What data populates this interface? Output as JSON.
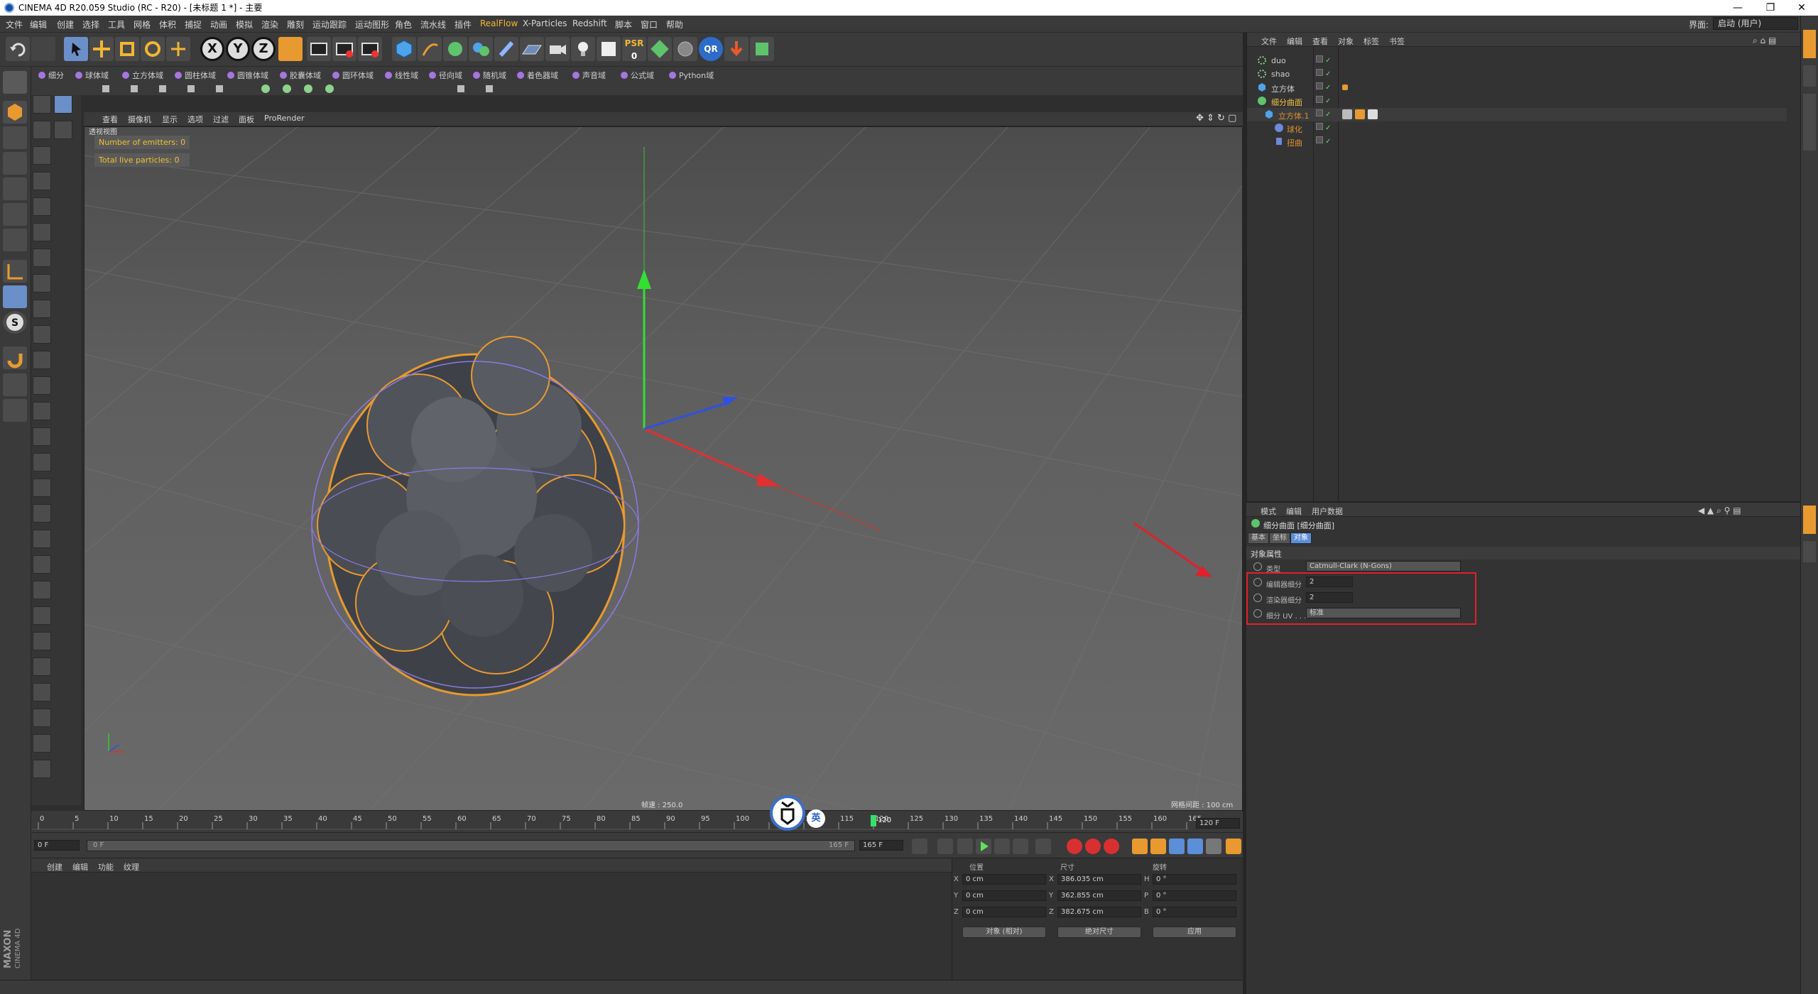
{
  "window": {
    "title": "CINEMA 4D R20.059 Studio (RC - R20) - [未标题 1 *] - 主要",
    "min": "—",
    "max": "❐",
    "close": "✕"
  },
  "menu": [
    "文件",
    "编辑",
    "创建",
    "选择",
    "工具",
    "网格",
    "体积",
    "捕捉",
    "动画",
    "模拟",
    "渲染",
    "雕刻",
    "运动跟踪",
    "运动图形",
    "角色",
    "流水线",
    "插件",
    "RealFlow",
    "X-Particles",
    "Redshift",
    "脚本",
    "窗口",
    "帮助"
  ],
  "layout": {
    "label": "界面:",
    "value": "启动 (用户)"
  },
  "toolbar": {
    "xyz": [
      "X",
      "Y",
      "Z"
    ],
    "psr": "PSR",
    "psr_num": "0",
    "qr": "QR"
  },
  "generators": [
    "细分",
    "球体域",
    "立方体域",
    "圆柱体域",
    "圆锥体域",
    "胶囊体域",
    "圆环体域",
    "线性域",
    "径向域",
    "随机域",
    "着色器域",
    "声音域",
    "公式域",
    "Python域"
  ],
  "viewport": {
    "menu": [
      "查看",
      "摄像机",
      "显示",
      "选项",
      "过滤",
      "面板",
      "ProRender"
    ],
    "hud": [
      "Number of emitters: 0",
      "Total live particles: 0"
    ],
    "speed": "帧速 : 250.0",
    "grid": "网格间距 : 100 cm",
    "view_label": "透视视图"
  },
  "timeline": {
    "ticks": [
      "0",
      "5",
      "10",
      "15",
      "20",
      "25",
      "30",
      "35",
      "40",
      "45",
      "50",
      "55",
      "60",
      "65",
      "70",
      "75",
      "80",
      "85",
      "90",
      "95",
      "100",
      "105",
      "110",
      "115",
      "120",
      "125",
      "130",
      "135",
      "140",
      "145",
      "150",
      "155",
      "160",
      "165"
    ],
    "current": "120",
    "end_field": "120 F",
    "start_frame": "0 F",
    "slider_start": "0 F",
    "slider_end": "165 F",
    "end_frame": "165 F",
    "lang": "英"
  },
  "materials": {
    "menu": [
      "创建",
      "编辑",
      "功能",
      "纹理"
    ]
  },
  "coords": {
    "headers": [
      "位置",
      "尺寸",
      "旋转"
    ],
    "rows": [
      {
        "axis": "X",
        "pos": "0 cm",
        "size_axis": "X",
        "size": "386.035 cm",
        "rot_axis": "H",
        "rot": "0 °"
      },
      {
        "axis": "Y",
        "pos": "0 cm",
        "size_axis": "Y",
        "size": "362.855 cm",
        "rot_axis": "P",
        "rot": "0 °"
      },
      {
        "axis": "Z",
        "pos": "0 cm",
        "size_axis": "Z",
        "size": "382.675 cm",
        "rot_axis": "B",
        "rot": "0 °"
      }
    ],
    "mode": "对象 (相对)",
    "size_mode": "绝对尺寸",
    "apply": "应用"
  },
  "objects": {
    "menu": [
      "文件",
      "编辑",
      "查看",
      "对象",
      "标签",
      "书签"
    ],
    "items": [
      {
        "name": "duo",
        "indent": 0,
        "color": "#cfcfcf"
      },
      {
        "name": "shao",
        "indent": 0,
        "color": "#cfcfcf"
      },
      {
        "name": "立方体",
        "indent": 0,
        "color": "#cfcfcf"
      },
      {
        "name": "细分曲面",
        "indent": 0,
        "color": "#f0c040"
      },
      {
        "name": "立方体.1",
        "indent": 1,
        "color": "#e09030"
      },
      {
        "name": "球化",
        "indent": 2,
        "color": "#e09030"
      },
      {
        "name": "扭曲",
        "indent": 2,
        "color": "#e09030"
      }
    ]
  },
  "attributes": {
    "menu": [
      "模式",
      "编辑",
      "用户数据"
    ],
    "title": "细分曲面 [细分曲面]",
    "tabs": [
      "基本",
      "坐标",
      "对象"
    ],
    "section": "对象属性",
    "fields": [
      {
        "label": "类型",
        "value": "Catmull-Clark (N-Gons)"
      },
      {
        "label": "编辑器细分",
        "value": "2"
      },
      {
        "label": "渲染器细分",
        "value": "2"
      },
      {
        "label": "细分 UV . . .",
        "value": "标准"
      }
    ]
  },
  "brand": {
    "maxon": "MAXON",
    "c4d": "CINEMA 4D"
  },
  "colors": {
    "accent": "#f2b633",
    "highlight_box": "#e0202a",
    "arrow": "#e0202a"
  }
}
